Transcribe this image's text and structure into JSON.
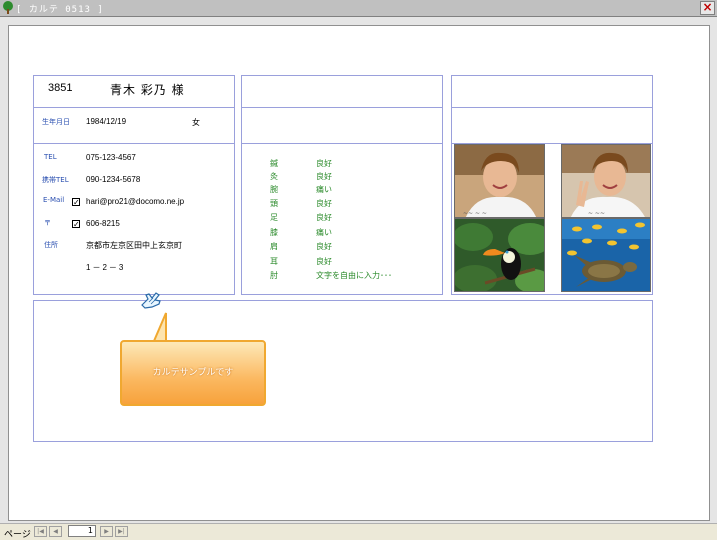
{
  "window": {
    "title": "[ カルテ 0513 ]",
    "close_label": "×"
  },
  "profile": {
    "id": "3851",
    "name": "青木 彩乃 様",
    "birthday_label": "生年月日",
    "birthday": "1984/12/19",
    "gender": "女",
    "tel_label": "TEL",
    "tel": "075-123-4567",
    "mobile_label": "携帯TEL",
    "mobile": "090-1234-5678",
    "email_label": "E-Mail",
    "email": "hari@pro21@docomo.ne.jp",
    "email_checked": "✓",
    "zip_label": "〒",
    "zip": "606-8215",
    "zip_checked": "✓",
    "address_label": "住所",
    "address_line1": "京都市左京区田中上玄京町",
    "address_line2": "1－2－3"
  },
  "conditions": [
    {
      "part": "鍼",
      "status": "良好"
    },
    {
      "part": "灸",
      "status": "良好"
    },
    {
      "part": "腕",
      "status": "痛い"
    },
    {
      "part": "頭",
      "status": "良好"
    },
    {
      "part": "足",
      "status": "良好"
    },
    {
      "part": "膝",
      "status": "痛い"
    },
    {
      "part": "肩",
      "status": "良好"
    },
    {
      "part": "耳",
      "status": "良好"
    },
    {
      "part": "肘",
      "status": "文字を自由に入力･･･"
    }
  ],
  "photos": [
    {
      "icon": "portrait-photo"
    },
    {
      "icon": "portrait-peace-photo"
    },
    {
      "icon": "toucan-photo"
    },
    {
      "icon": "sea-turtle-photo"
    }
  ],
  "callout": {
    "text": "カルテサンプルです"
  },
  "statusbar": {
    "page_label": "ページ",
    "page_number": "1"
  },
  "colors": {
    "border": "#9aa0dc",
    "label_blue": "#2a4fb0",
    "condition_green": "#2a8a2a",
    "callout_orange": "#f7a23c"
  }
}
